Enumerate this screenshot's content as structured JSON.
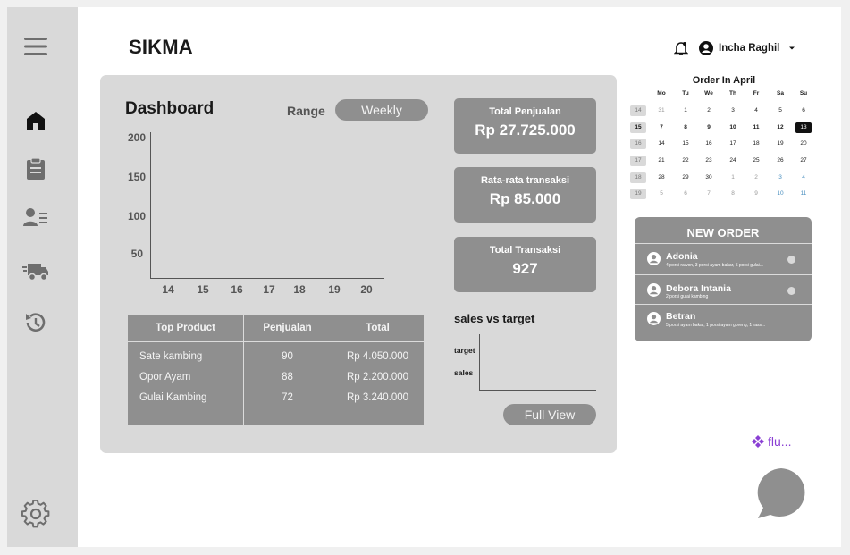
{
  "app": {
    "name": "SIKMA"
  },
  "sidebar": {
    "icons": [
      "menu-icon",
      "home-icon",
      "clipboard-icon",
      "contacts-icon",
      "delivery-truck-icon",
      "history-icon",
      "settings-icon"
    ]
  },
  "header": {
    "user_name": "Incha Raghil"
  },
  "dashboard": {
    "title": "Dashboard",
    "range_label": "Range",
    "range_value": "Weekly",
    "chart": {
      "yticks": [
        "200",
        "150",
        "100",
        "50"
      ],
      "xticks": [
        "14",
        "15",
        "16",
        "17",
        "18",
        "19",
        "20"
      ]
    }
  },
  "chart_data": {
    "type": "bar",
    "categories": [
      "14",
      "15",
      "16",
      "17",
      "18",
      "19",
      "20"
    ],
    "series": [],
    "ylim": [
      0,
      200
    ]
  },
  "top_products": {
    "headers": [
      "Top Product",
      "Penjualan",
      "Total"
    ],
    "rows": [
      [
        "Sate kambing",
        "90",
        "Rp 4.050.000"
      ],
      [
        "Opor Ayam",
        "88",
        "Rp 2.200.000"
      ],
      [
        "Gulai Kambing",
        "72",
        "Rp 3.240.000"
      ]
    ]
  },
  "stats": [
    {
      "label": "Total Penjualan",
      "value": "Rp 27.725.000"
    },
    {
      "label": "Rata-rata transaksi",
      "value": "Rp 85.000"
    },
    {
      "label": "Total Transaksi",
      "value": "927"
    }
  ],
  "sales_vs_target": {
    "title": "sales vs target",
    "labels": [
      "target",
      "sales"
    ],
    "button": "Full View"
  },
  "calendar": {
    "title": "Order In April",
    "day_headers": [
      "Mo",
      "Tu",
      "We",
      "Th",
      "Fr",
      "Sa",
      "Su"
    ],
    "weeks": [
      {
        "num": "14",
        "days": [
          "31",
          "1",
          "2",
          "3",
          "4",
          "5",
          "6"
        ]
      },
      {
        "num": "15",
        "days": [
          "7",
          "8",
          "9",
          "10",
          "11",
          "12",
          "13"
        ]
      },
      {
        "num": "16",
        "days": [
          "14",
          "15",
          "16",
          "17",
          "18",
          "19",
          "20"
        ]
      },
      {
        "num": "17",
        "days": [
          "21",
          "22",
          "23",
          "24",
          "25",
          "26",
          "27"
        ]
      },
      {
        "num": "18",
        "days": [
          "28",
          "29",
          "30",
          "1",
          "2",
          "3",
          "4"
        ]
      },
      {
        "num": "19",
        "days": [
          "5",
          "6",
          "7",
          "8",
          "9",
          "10",
          "11"
        ]
      }
    ],
    "selected_day": "13",
    "current_week": "15"
  },
  "new_order": {
    "title": "NEW ORDER",
    "items": [
      {
        "name": "Adonia",
        "desc": "4 porsi rawon, 3 porsi ayam bakar, 5 porsi gulai..."
      },
      {
        "name": "Debora Intania",
        "desc": "2 porsi gulai kambing"
      },
      {
        "name": "Betran",
        "desc": "5 porsi ayam bakar, 1 porsi ayam goreng, 1 rass..."
      }
    ]
  },
  "plugin": {
    "label": "flu..."
  }
}
